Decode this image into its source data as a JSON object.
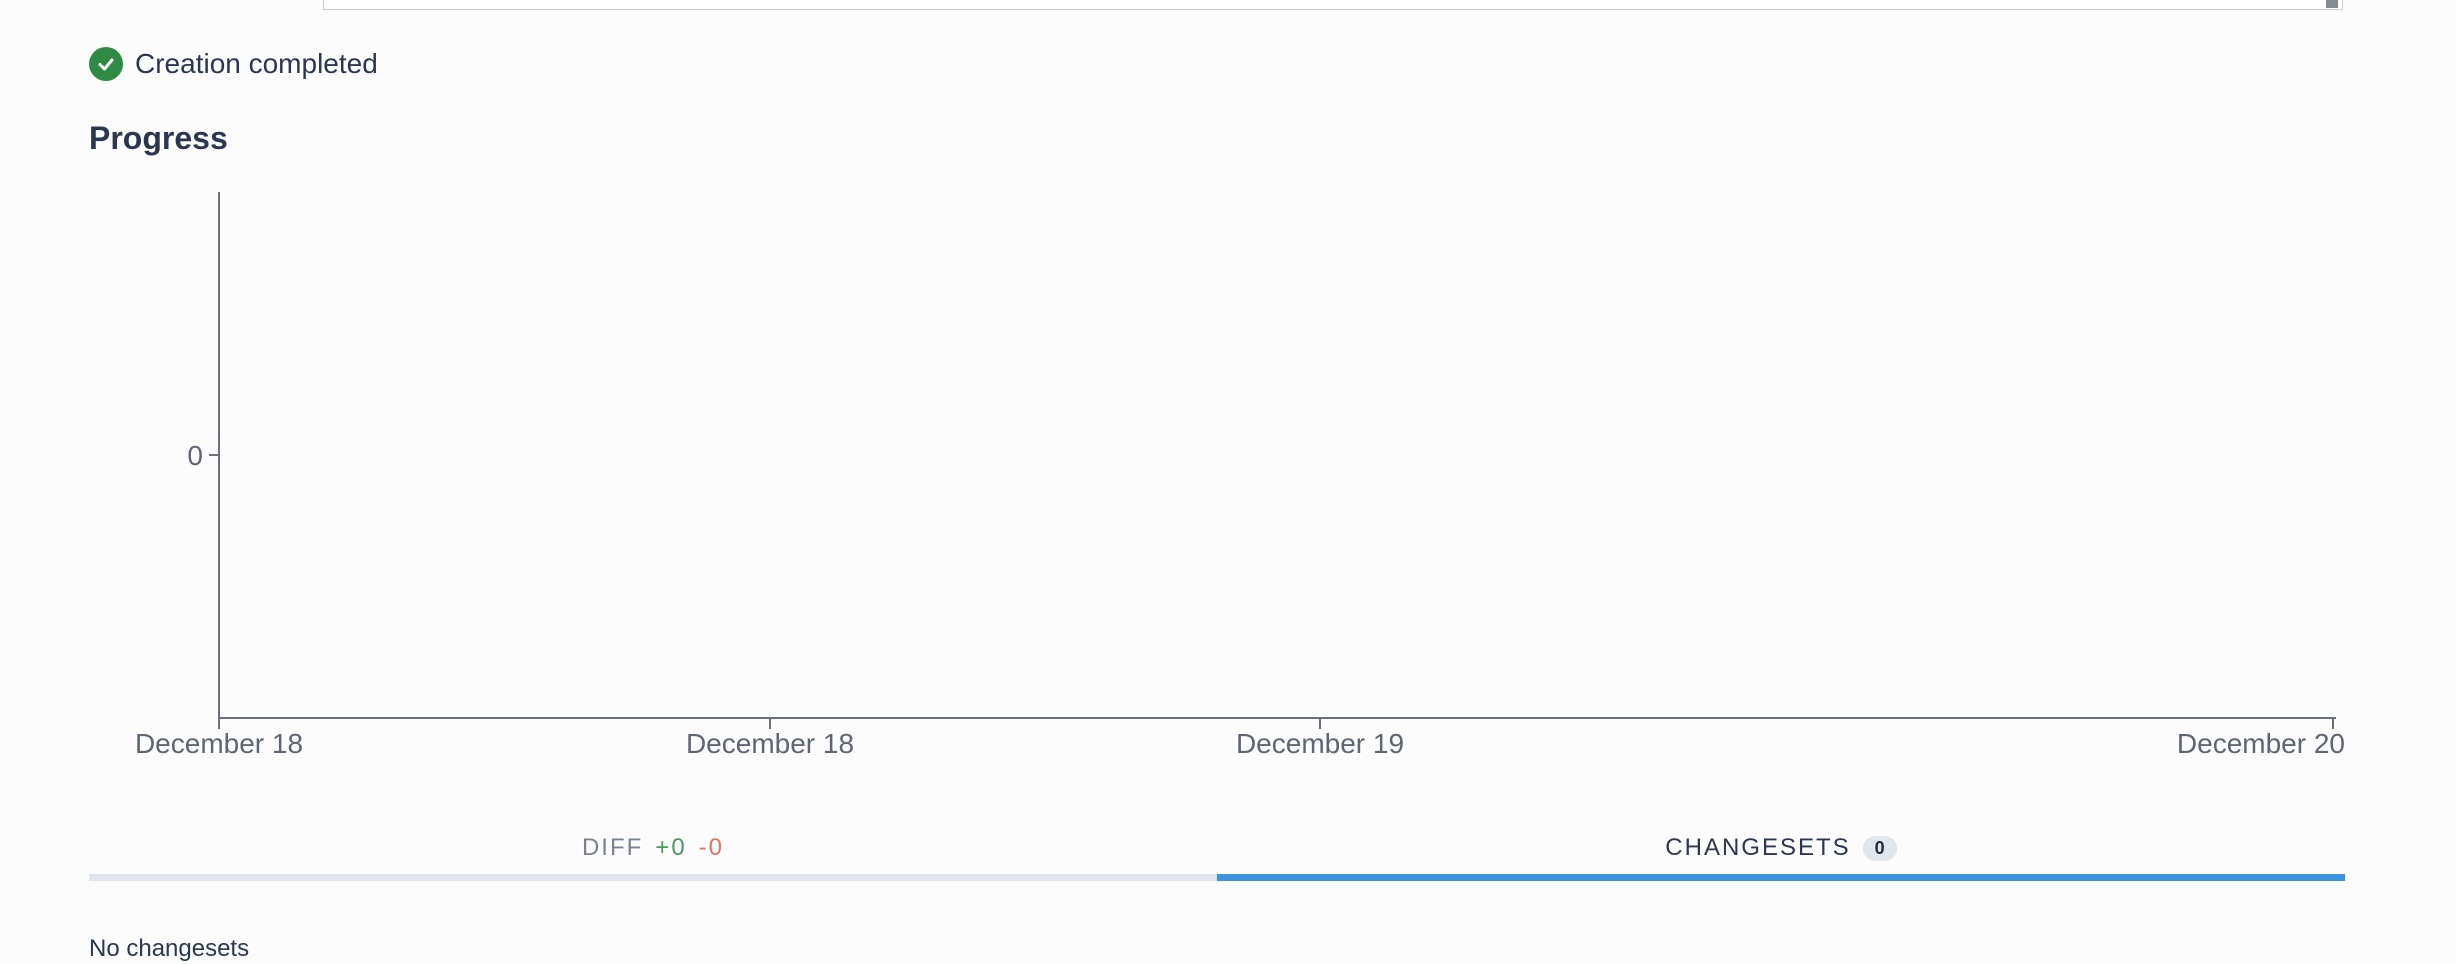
{
  "status": {
    "text": "Creation completed",
    "icon": "check-circle-icon",
    "color": "#2f8a43"
  },
  "section": {
    "title": "Progress"
  },
  "chart_data": {
    "type": "line",
    "title": "",
    "xlabel": "",
    "ylabel": "",
    "x_ticks": [
      "December 18",
      "December 18",
      "December 19",
      "December 20"
    ],
    "y_ticks": [
      "0"
    ],
    "series": [],
    "grid": false
  },
  "tabs": {
    "diff": {
      "label": "DIFF",
      "added": "+0",
      "removed": "-0",
      "added_color": "#4c9a5b",
      "removed_color": "#e07560"
    },
    "changesets": {
      "label": "CHANGESETS",
      "count": "0",
      "active_color": "#3a93dc"
    }
  },
  "empty_message": "No changesets"
}
